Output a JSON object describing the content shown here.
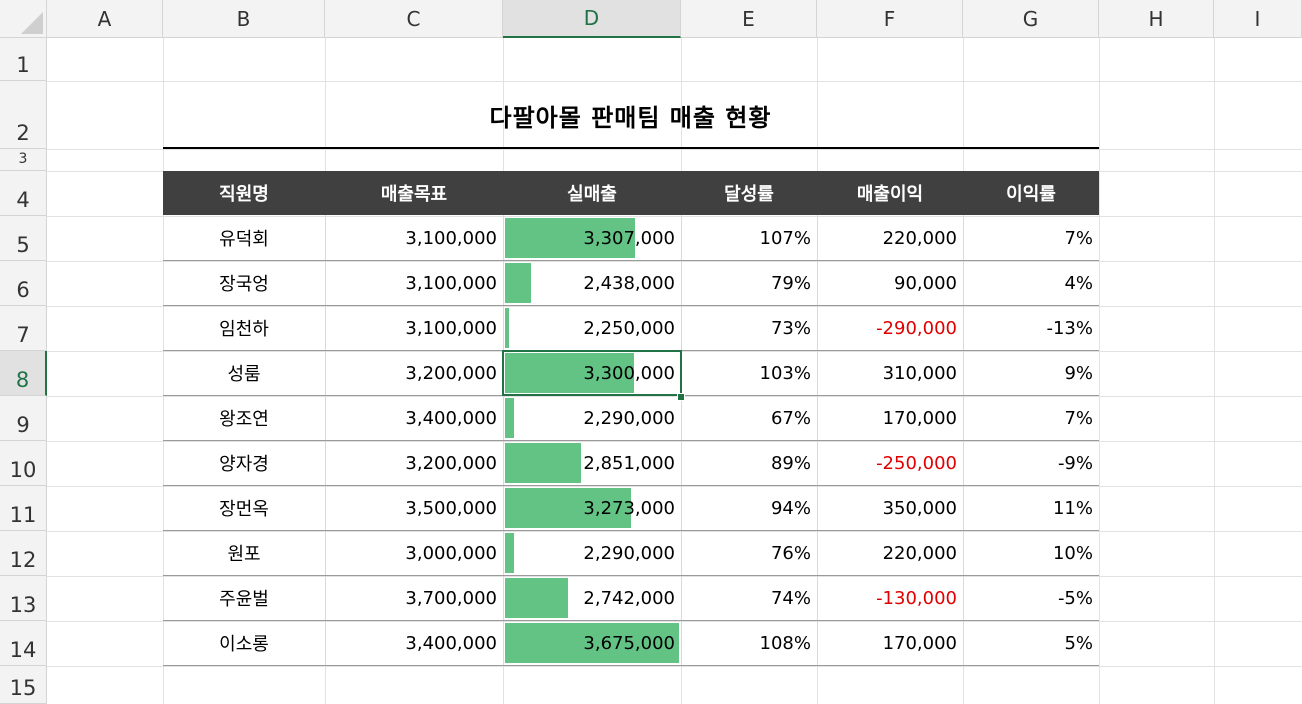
{
  "columns": [
    "A",
    "B",
    "C",
    "D",
    "E",
    "F",
    "G",
    "H",
    "I"
  ],
  "rows": [
    "1",
    "2",
    "3",
    "4",
    "5",
    "6",
    "7",
    "8",
    "9",
    "10",
    "11",
    "12",
    "13",
    "14",
    "15"
  ],
  "selected_cell": {
    "column": "D",
    "row": "8"
  },
  "title": "다팔아몰 판매팀 매출 현황",
  "headers": [
    "직원명",
    "매출목표",
    "실매출",
    "달성률",
    "매출이익",
    "이익률"
  ],
  "colors": {
    "header_bg": "#404040",
    "databar": "#63c384",
    "negative": "#e00000",
    "selection": "#217346"
  },
  "data": [
    {
      "name": "유덕회",
      "target": "3,100,000",
      "actual": "3,307,000",
      "actual_value": 3307000,
      "rate": "107%",
      "profit": "220,000",
      "profit_negative": false,
      "margin": "7%"
    },
    {
      "name": "장국엉",
      "target": "3,100,000",
      "actual": "2,438,000",
      "actual_value": 2438000,
      "rate": "79%",
      "profit": "90,000",
      "profit_negative": false,
      "margin": "4%"
    },
    {
      "name": "임천하",
      "target": "3,100,000",
      "actual": "2,250,000",
      "actual_value": 2250000,
      "rate": "73%",
      "profit": "-290,000",
      "profit_negative": true,
      "margin": "-13%"
    },
    {
      "name": "성룸",
      "target": "3,200,000",
      "actual": "3,300,000",
      "actual_value": 3300000,
      "rate": "103%",
      "profit": "310,000",
      "profit_negative": false,
      "margin": "9%"
    },
    {
      "name": "왕조연",
      "target": "3,400,000",
      "actual": "2,290,000",
      "actual_value": 2290000,
      "rate": "67%",
      "profit": "170,000",
      "profit_negative": false,
      "margin": "7%"
    },
    {
      "name": "양자경",
      "target": "3,200,000",
      "actual": "2,851,000",
      "actual_value": 2851000,
      "rate": "89%",
      "profit": "-250,000",
      "profit_negative": true,
      "margin": "-9%"
    },
    {
      "name": "장먼옥",
      "target": "3,500,000",
      "actual": "3,273,000",
      "actual_value": 3273000,
      "rate": "94%",
      "profit": "350,000",
      "profit_negative": false,
      "margin": "11%"
    },
    {
      "name": "원포",
      "target": "3,000,000",
      "actual": "2,290,000",
      "actual_value": 2290000,
      "rate": "76%",
      "profit": "220,000",
      "profit_negative": false,
      "margin": "10%"
    },
    {
      "name": "주윤벌",
      "target": "3,700,000",
      "actual": "2,742,000",
      "actual_value": 2742000,
      "rate": "74%",
      "profit": "-130,000",
      "profit_negative": true,
      "margin": "-5%"
    },
    {
      "name": "이소롱",
      "target": "3,400,000",
      "actual": "3,675,000",
      "actual_value": 3675000,
      "rate": "108%",
      "profit": "170,000",
      "profit_negative": false,
      "margin": "5%"
    }
  ]
}
